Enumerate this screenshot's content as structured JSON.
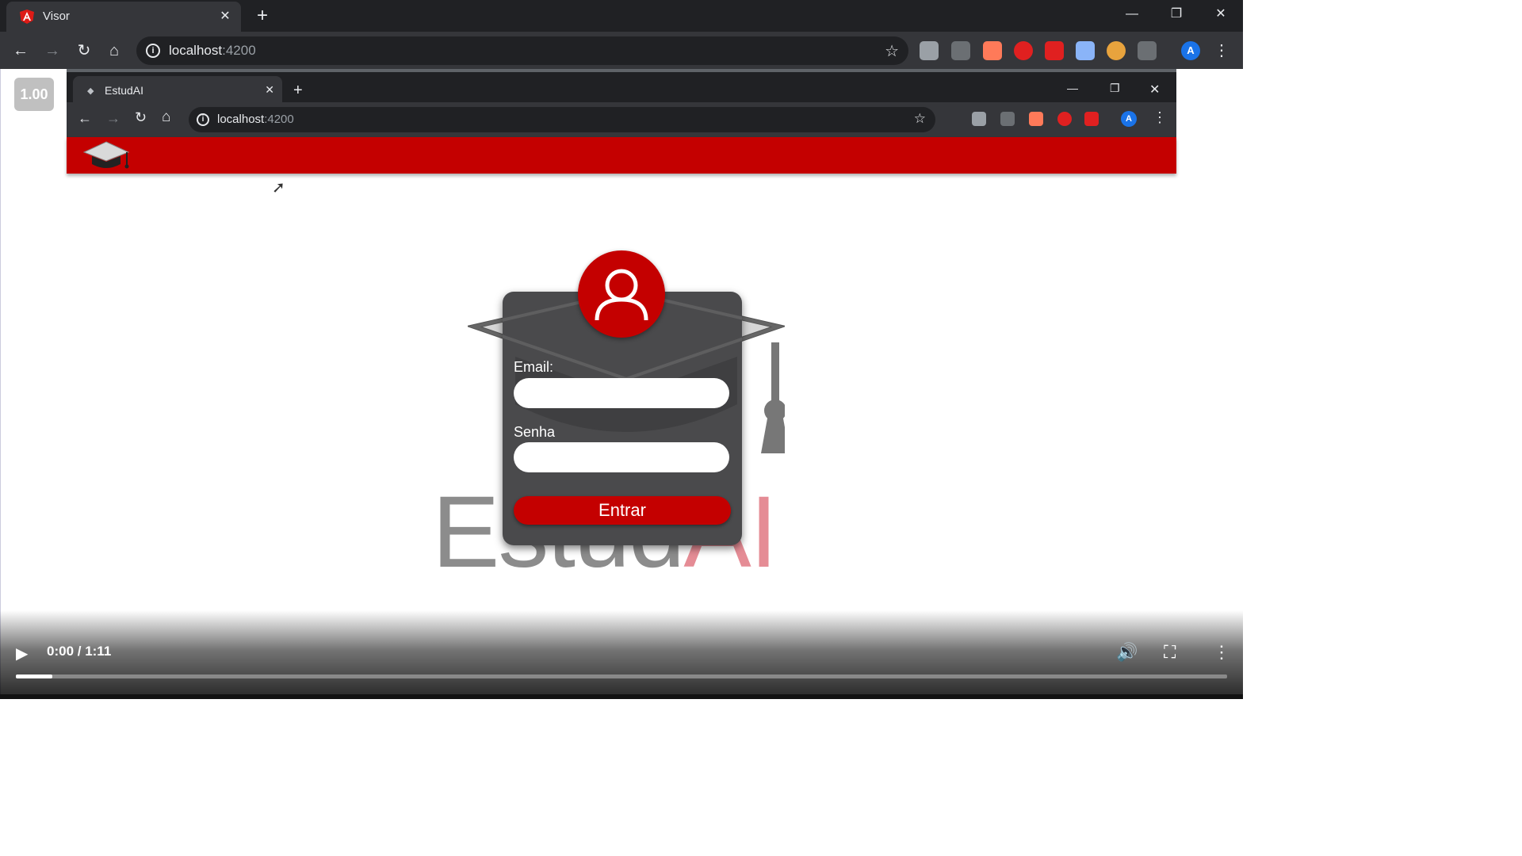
{
  "browser": {
    "tab_title": "Visor",
    "url_host": "localhost",
    "url_port": ":4200",
    "avatar_letter": "A"
  },
  "viewer": {
    "zoom_label": "1.00"
  },
  "inner_browser": {
    "tab_title": "EstudAI",
    "url_host": "localhost",
    "url_port": ":4200",
    "avatar_letter": "A"
  },
  "login": {
    "email_label": "Email:",
    "password_label": "Senha",
    "submit_label": "Entrar",
    "brand_left": "Estud",
    "brand_right": "AI"
  },
  "video": {
    "time_label": "0:00 / 1:11",
    "progress": 0.03
  },
  "colors": {
    "brand_red": "#c40000",
    "chrome_dark": "#202124",
    "chrome_toolbar": "#35363a"
  }
}
